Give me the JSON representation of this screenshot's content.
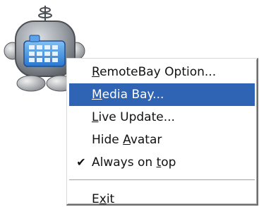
{
  "menu": {
    "items": [
      {
        "pre": "",
        "acc": "R",
        "post": "emoteBay Option...",
        "checked": false,
        "highlighted": false
      },
      {
        "pre": "",
        "acc": "M",
        "post": "edia Bay...",
        "checked": false,
        "highlighted": true
      },
      {
        "pre": "",
        "acc": "L",
        "post": "ive Update...",
        "checked": false,
        "highlighted": false
      },
      {
        "pre": "Hide ",
        "acc": "A",
        "post": "vatar",
        "checked": false,
        "highlighted": false
      },
      {
        "pre": "Always on ",
        "acc": "t",
        "post": "op",
        "checked": true,
        "highlighted": false
      }
    ],
    "exit": {
      "pre": "E",
      "acc": "x",
      "post": "it"
    },
    "check_glyph": "✔"
  },
  "colors": {
    "highlight": "#2f63b4",
    "robot_body": "#8f9499",
    "robot_screen": "#3d8ee0"
  }
}
